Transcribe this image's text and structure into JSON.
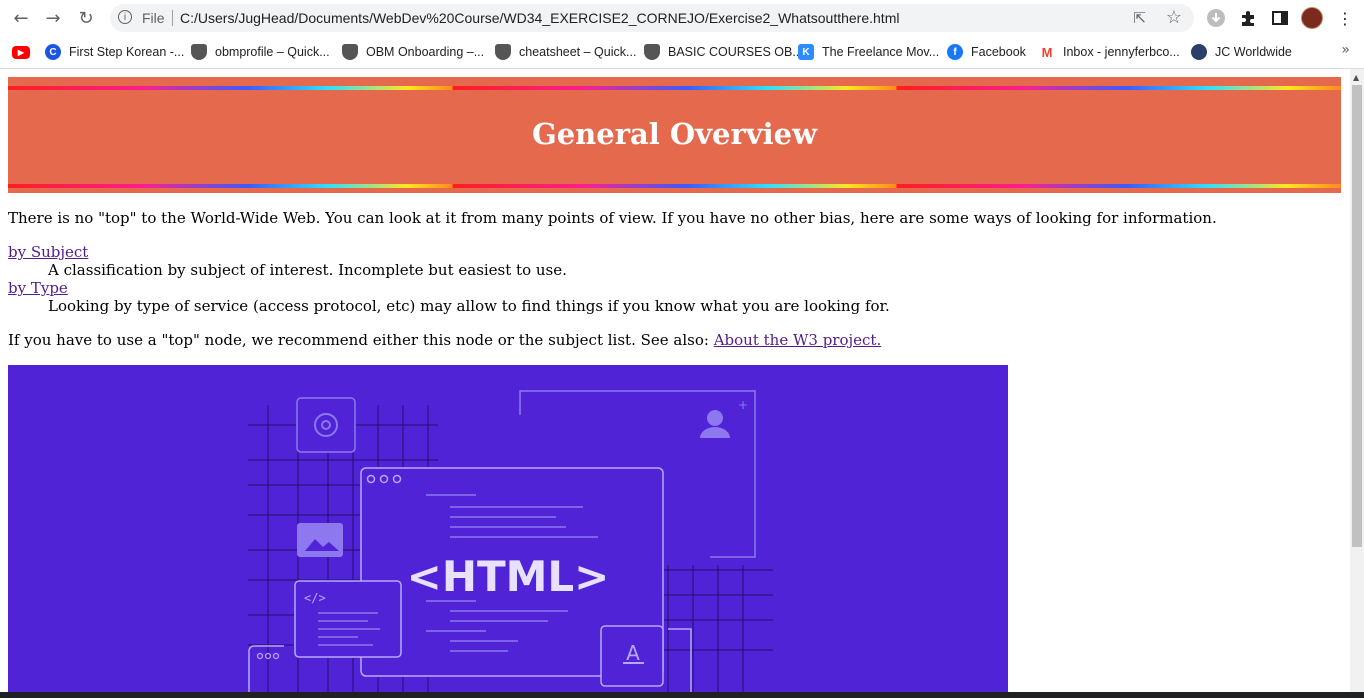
{
  "browser": {
    "address_scheme": "File",
    "address_url": "C:/Users/JugHead/Documents/WebDev%20Course/WD34_EXERCISE2_CORNEJO/Exercise2_Whatsoutthere.html",
    "bookmarks": [
      {
        "label": "First Step Korean -..."
      },
      {
        "label": "obmprofile – Quick..."
      },
      {
        "label": "OBM Onboarding –..."
      },
      {
        "label": "cheatsheet – Quick..."
      },
      {
        "label": "BASIC COURSES OB..."
      },
      {
        "label": "The Freelance Mov..."
      },
      {
        "label": "Facebook"
      },
      {
        "label": "Inbox - jennyferbco..."
      },
      {
        "label": "JC Worldwide"
      }
    ]
  },
  "page": {
    "title": "General Overview",
    "intro": "There is no \"top\" to the World-Wide Web. You can look at it from many points of view. If you have no other bias, here are some ways of looking for information.",
    "definitions": [
      {
        "term": "by Subject",
        "description": "A classification by subject of interest. Incomplete but easiest to use."
      },
      {
        "term": "by Type",
        "description": "Looking by type of service (access protocol, etc) may allow to find things if you know what you are looking for."
      }
    ],
    "closing": "If you have to use a \"top\" node, we recommend either this node or the subject list. See also: ",
    "closing_link": "About the W3 project.",
    "hero_text": "<HTML>"
  },
  "colors": {
    "header_bg": "#e4694d",
    "hero_bg": "#5123d6",
    "link": "#551a8b"
  }
}
